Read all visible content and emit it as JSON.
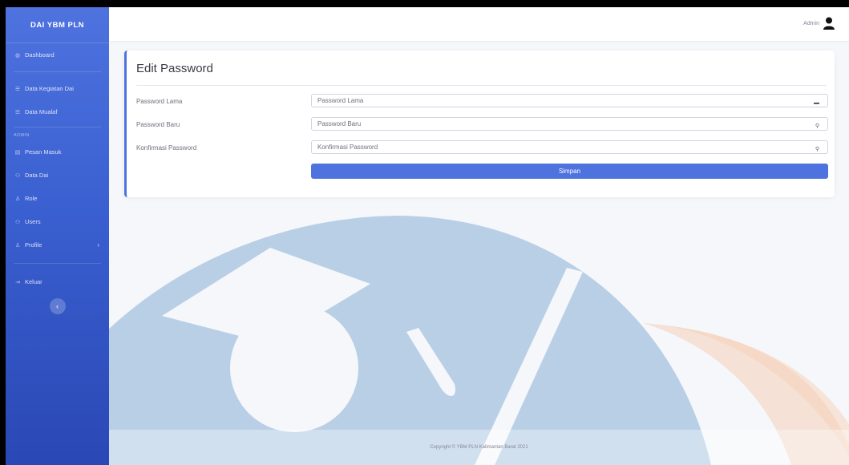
{
  "brand": "DAI YBM PLN",
  "sidebar": {
    "items": [
      {
        "label": "Dashboard",
        "icon": "dashboard-icon"
      },
      {
        "label": "Data Kegiatan Dai",
        "icon": "table-icon"
      },
      {
        "label": "Data Mualaf",
        "icon": "table-icon"
      }
    ],
    "admin_heading": "ADMIN",
    "admin_items": [
      {
        "label": "Pesan Masuk",
        "icon": "inbox-icon"
      },
      {
        "label": "Data Dai",
        "icon": "users-icon"
      },
      {
        "label": "Role",
        "icon": "user-icon"
      },
      {
        "label": "Users",
        "icon": "users-icon"
      },
      {
        "label": "Profile",
        "icon": "user-icon"
      }
    ],
    "logout": "Keluar"
  },
  "topbar": {
    "user": "Admin"
  },
  "form": {
    "title": "Edit Password",
    "fields": [
      {
        "label": "Password Lama",
        "placeholder": "Password Lama"
      },
      {
        "label": "Password Baru",
        "placeholder": "Password Baru"
      },
      {
        "label": "Konfirmasi Password",
        "placeholder": "Konfirmasi Password"
      }
    ],
    "submit": "Simpan"
  },
  "footer": "Copyright © YBM PLN Kalimantan Barat 2021",
  "colors": {
    "primary": "#4e73df",
    "watermark_blue": "#b9cfe6",
    "watermark_orange": "#f7dcc9"
  }
}
